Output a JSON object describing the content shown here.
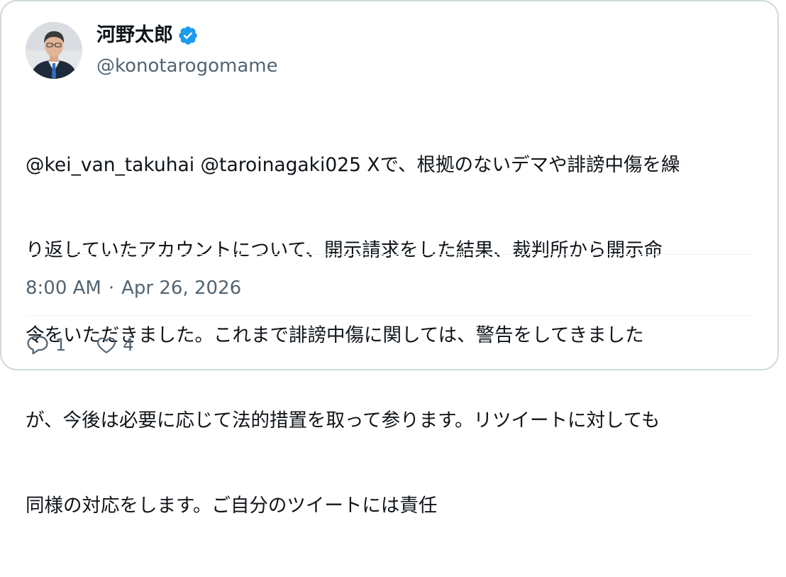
{
  "author": {
    "display_name": "河野太郎",
    "handle": "@konotarogomame",
    "verified": true,
    "verified_color": "#1d9bf0"
  },
  "tweet": {
    "text_lines": [
      "@kei_van_takuhai @taroinagaki025 Xで、根拠のないデマや誹謗中傷を繰",
      "り返していたアカウントについて、開示請求をした結果、裁判所から開示命",
      "令をいただきました。これまで誹謗中傷に関しては、警告をしてきました",
      "が、今後は必要に応じて法的措置を取って参ります。リツイートに対しても",
      "同様の対応をします。ご自分のツイートには責任"
    ]
  },
  "meta": {
    "time": "8:00 AM",
    "separator": "·",
    "date": "Apr 26, 2026"
  },
  "actions": {
    "replies_icon": "reply-bubble-icon",
    "replies_count": "1",
    "likes_icon": "heart-icon",
    "likes_count": "4"
  },
  "colors": {
    "text": "#0f1419",
    "secondary": "#536471",
    "border": "#cfd9de"
  }
}
